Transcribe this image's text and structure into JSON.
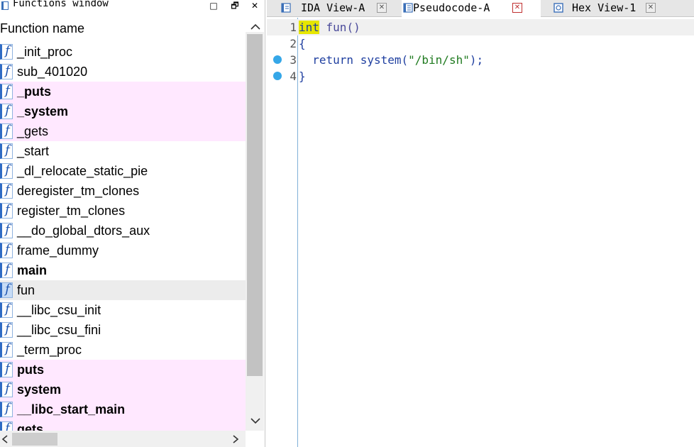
{
  "functions_window": {
    "title": "Functions window",
    "column_header": "Function name",
    "title_buttons": {
      "restore": "□",
      "float": "🗗",
      "close": "✕"
    },
    "functions": [
      {
        "name": "_init_proc",
        "bold": false,
        "imported": false,
        "selected": false
      },
      {
        "name": "sub_401020",
        "bold": false,
        "imported": false,
        "selected": false
      },
      {
        "name": "_puts",
        "bold": true,
        "imported": true,
        "selected": false
      },
      {
        "name": "_system",
        "bold": true,
        "imported": true,
        "selected": false
      },
      {
        "name": "_gets",
        "bold": false,
        "imported": true,
        "selected": false
      },
      {
        "name": "_start",
        "bold": false,
        "imported": false,
        "selected": false
      },
      {
        "name": "_dl_relocate_static_pie",
        "bold": false,
        "imported": false,
        "selected": false
      },
      {
        "name": "deregister_tm_clones",
        "bold": false,
        "imported": false,
        "selected": false
      },
      {
        "name": "register_tm_clones",
        "bold": false,
        "imported": false,
        "selected": false
      },
      {
        "name": "__do_global_dtors_aux",
        "bold": false,
        "imported": false,
        "selected": false
      },
      {
        "name": "frame_dummy",
        "bold": false,
        "imported": false,
        "selected": false
      },
      {
        "name": "main",
        "bold": true,
        "imported": false,
        "selected": false
      },
      {
        "name": "fun",
        "bold": false,
        "imported": false,
        "selected": true
      },
      {
        "name": "__libc_csu_init",
        "bold": false,
        "imported": false,
        "selected": false
      },
      {
        "name": "__libc_csu_fini",
        "bold": false,
        "imported": false,
        "selected": false
      },
      {
        "name": "_term_proc",
        "bold": false,
        "imported": false,
        "selected": false
      },
      {
        "name": "puts",
        "bold": true,
        "imported": true,
        "selected": false
      },
      {
        "name": "system",
        "bold": true,
        "imported": true,
        "selected": false
      },
      {
        "name": "__libc_start_main",
        "bold": true,
        "imported": true,
        "selected": false
      },
      {
        "name": "gets",
        "bold": true,
        "imported": true,
        "selected": false
      }
    ],
    "function_icon_glyph": "f"
  },
  "tabs": [
    {
      "label": "IDA View-A",
      "active": false,
      "icon": "disassembly-icon"
    },
    {
      "label": "Pseudocode-A",
      "active": true,
      "icon": "pseudocode-icon"
    },
    {
      "label": "Hex View-1",
      "active": false,
      "icon": "hex-icon"
    }
  ],
  "pseudocode": {
    "lines": [
      {
        "num": "1",
        "breakpoint": false
      },
      {
        "num": "2",
        "breakpoint": false
      },
      {
        "num": "3",
        "breakpoint": true
      },
      {
        "num": "4",
        "breakpoint": true
      }
    ],
    "line1": {
      "kw": "int",
      "rest": " fun()"
    },
    "line2": {
      "text": "{"
    },
    "line3": {
      "indent": "  ",
      "kw": "return",
      "sp": " ",
      "fn": "system",
      "open": "(",
      "str": "\"/bin/sh\"",
      "close": ");"
    },
    "line4": {
      "text": "}"
    }
  },
  "colors": {
    "import_highlight": "#ffe8ff",
    "selected_row": "#ececec",
    "keyword_highlight": "#e6e600",
    "breakpoint": "#35a7e8"
  }
}
